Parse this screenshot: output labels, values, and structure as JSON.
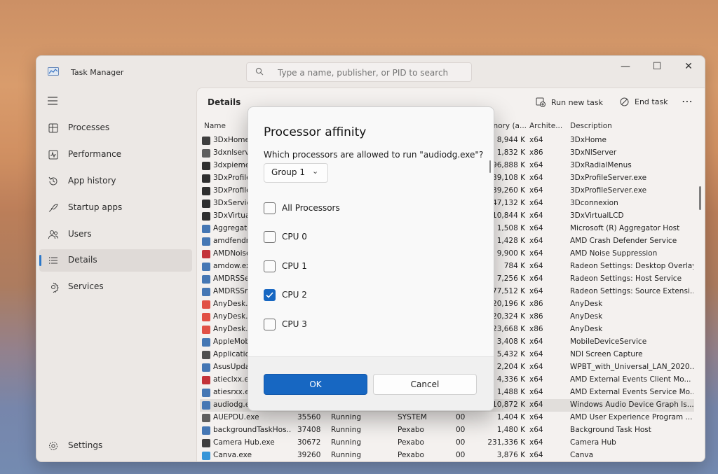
{
  "app": {
    "title": "Task Manager"
  },
  "search": {
    "placeholder": "Type a name, publisher, or PID to search"
  },
  "window_controls": {
    "minimize": "—",
    "maximize": "☐",
    "close": "✕"
  },
  "sidebar": {
    "items": [
      {
        "label": "Processes",
        "icon": "processes-icon"
      },
      {
        "label": "Performance",
        "icon": "performance-icon"
      },
      {
        "label": "App history",
        "icon": "app-history-icon"
      },
      {
        "label": "Startup apps",
        "icon": "startup-apps-icon"
      },
      {
        "label": "Users",
        "icon": "users-icon"
      },
      {
        "label": "Details",
        "icon": "details-icon",
        "active": true
      },
      {
        "label": "Services",
        "icon": "services-icon"
      }
    ],
    "settings": "Settings"
  },
  "content": {
    "heading": "Details",
    "run_new_task": "Run new task",
    "end_task": "End task",
    "more": "⋯",
    "columns": {
      "name": "Name",
      "memory": "nory (a...",
      "arch": "Archite...",
      "desc": "Description"
    },
    "rows": [
      {
        "name": "3DxHome.",
        "mem": "8,944 K",
        "arch": "x64",
        "desc": "3DxHome",
        "c": "#333"
      },
      {
        "name": "3dxnlserve",
        "mem": "1,832 K",
        "arch": "x86",
        "desc": "3DxNlServer",
        "c": "#555"
      },
      {
        "name": "3dxpiemer",
        "mem": "96,888 K",
        "arch": "x64",
        "desc": "3DxRadialMenus",
        "c": "#222"
      },
      {
        "name": "3DxProfile",
        "mem": "39,108 K",
        "arch": "x64",
        "desc": "3DxProfileServer.exe",
        "c": "#222"
      },
      {
        "name": "3DxProfile",
        "mem": "39,260 K",
        "arch": "x64",
        "desc": "3DxProfileServer.exe",
        "c": "#222"
      },
      {
        "name": "3DxService",
        "mem": "47,132 K",
        "arch": "x64",
        "desc": "3Dconnexion",
        "c": "#222"
      },
      {
        "name": "3DxVirtual",
        "mem": "10,844 K",
        "arch": "x64",
        "desc": "3DxVirtualLCD",
        "c": "#222"
      },
      {
        "name": "Aggregato",
        "mem": "1,508 K",
        "arch": "x64",
        "desc": "Microsoft (R) Aggregator Host",
        "c": "#3a6fb0"
      },
      {
        "name": "amdfendrs",
        "mem": "1,428 K",
        "arch": "x64",
        "desc": "AMD Crash Defender Service",
        "c": "#3a6fb0"
      },
      {
        "name": "AMDNoise",
        "mem": "9,900 K",
        "arch": "x64",
        "desc": "AMD Noise Suppression",
        "c": "#c0262d"
      },
      {
        "name": "amdow.ex",
        "mem": "784 K",
        "arch": "x64",
        "desc": "Radeon Settings: Desktop Overlay",
        "c": "#3a6fb0"
      },
      {
        "name": "AMDRSSer",
        "mem": "7,256 K",
        "arch": "x64",
        "desc": "Radeon Settings: Host Service",
        "c": "#3a6fb0"
      },
      {
        "name": "AMDRSSrc",
        "mem": "77,512 K",
        "arch": "x64",
        "desc": "Radeon Settings: Source Extensi...",
        "c": "#3a6fb0"
      },
      {
        "name": "AnyDesk.e",
        "mem": "20,196 K",
        "arch": "x86",
        "desc": "AnyDesk",
        "c": "#e0463a"
      },
      {
        "name": "AnyDesk.e",
        "mem": "20,324 K",
        "arch": "x86",
        "desc": "AnyDesk",
        "c": "#e0463a"
      },
      {
        "name": "AnyDesk.e",
        "mem": "23,668 K",
        "arch": "x86",
        "desc": "AnyDesk",
        "c": "#e0463a"
      },
      {
        "name": "AppleMob",
        "mem": "3,408 K",
        "arch": "x64",
        "desc": "MobileDeviceService",
        "c": "#3a6fb0"
      },
      {
        "name": "Applicatio",
        "mem": "5,432 K",
        "arch": "x64",
        "desc": "NDI Screen Capture",
        "c": "#444"
      },
      {
        "name": "AsusUpdat",
        "mem": "2,204 K",
        "arch": "x64",
        "desc": "WPBT_with_Universal_LAN_2020...",
        "c": "#3a6fb0"
      },
      {
        "name": "atieclxx.ex",
        "mem": "4,336 K",
        "arch": "x64",
        "desc": "AMD External Events Client Mo...",
        "c": "#c0262d"
      },
      {
        "name": "atiesrxx.ex",
        "mem": "1,488 K",
        "arch": "x64",
        "desc": "AMD External Events Service Mo...",
        "c": "#3a6fb0"
      },
      {
        "name": "audiodg.e",
        "mem": "10,872 K",
        "arch": "x64",
        "desc": "Windows Audio Device Graph Is...",
        "c": "#3a6fb0",
        "sel": true
      },
      {
        "name": "AUEPDU.exe",
        "pid": "35560",
        "status": "Running",
        "user": "SYSTEM",
        "cpu": "00",
        "mem": "1,404 K",
        "arch": "x64",
        "desc": "AMD User Experience Program ...",
        "c": "#555"
      },
      {
        "name": "backgroundTaskHos...",
        "pid": "37408",
        "status": "Running",
        "user": "Pexabo",
        "cpu": "00",
        "mem": "1,480 K",
        "arch": "x64",
        "desc": "Background Task Host",
        "c": "#3a6fb0"
      },
      {
        "name": "Camera Hub.exe",
        "pid": "30672",
        "status": "Running",
        "user": "Pexabo",
        "cpu": "00",
        "mem": "231,336 K",
        "arch": "x64",
        "desc": "Camera Hub",
        "c": "#333"
      },
      {
        "name": "Canva.exe",
        "pid": "39260",
        "status": "Running",
        "user": "Pexabo",
        "cpu": "00",
        "mem": "3,876 K",
        "arch": "x64",
        "desc": "Canva",
        "c": "#2a8fd6"
      }
    ]
  },
  "dialog": {
    "title": "Processor affinity",
    "question": "Which processors are allowed to run \"audiodg.exe\"?",
    "group": "Group 1",
    "options": [
      {
        "label": "All Processors",
        "checked": false
      },
      {
        "label": "CPU 0",
        "checked": false
      },
      {
        "label": "CPU 1",
        "checked": false
      },
      {
        "label": "CPU 2",
        "checked": true
      },
      {
        "label": "CPU 3",
        "checked": false
      }
    ],
    "ok": "OK",
    "cancel": "Cancel"
  }
}
